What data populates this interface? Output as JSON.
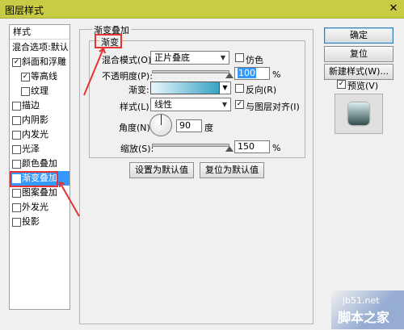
{
  "window": {
    "title": "图层样式",
    "close_glyph": "✕"
  },
  "style_list": {
    "header": "样式",
    "blend_options": "混合选项:默认",
    "items": [
      {
        "label": "斜面和浮雕",
        "checked": true,
        "sub": false
      },
      {
        "label": "等高线",
        "checked": true,
        "sub": true
      },
      {
        "label": "纹理",
        "checked": false,
        "sub": true
      },
      {
        "label": "描边",
        "checked": false,
        "sub": false
      },
      {
        "label": "内阴影",
        "checked": false,
        "sub": false
      },
      {
        "label": "内发光",
        "checked": false,
        "sub": false
      },
      {
        "label": "光泽",
        "checked": false,
        "sub": false
      },
      {
        "label": "颜色叠加",
        "checked": false,
        "sub": false
      },
      {
        "label": "渐变叠加",
        "checked": true,
        "sub": false,
        "selected": true
      },
      {
        "label": "图案叠加",
        "checked": false,
        "sub": false
      },
      {
        "label": "外发光",
        "checked": false,
        "sub": false
      },
      {
        "label": "投影",
        "checked": false,
        "sub": false
      }
    ]
  },
  "panel": {
    "group_title": "渐变叠加",
    "subgroup_title": "渐变",
    "blend_mode_label": "混合模式(O):",
    "blend_mode_value": "正片叠底",
    "dither_label": "仿色",
    "opacity_label": "不透明度(P):",
    "opacity_value": "100",
    "opacity_unit": "%",
    "gradient_label": "渐变:",
    "gradient_colors": [
      "#e9f6fb",
      "#37a3c4"
    ],
    "reverse_label": "反向(R)",
    "style_label": "样式(L):",
    "style_value": "线性",
    "align_label": "与图层对齐(I)",
    "align_checked": true,
    "angle_label": "角度(N):",
    "angle_value": "90",
    "angle_unit": "度",
    "scale_label": "缩放(S):",
    "scale_value": "150",
    "scale_unit": "%",
    "set_default_button": "设置为默认值",
    "reset_default_button": "复位为默认值"
  },
  "right_buttons": {
    "ok": "确定",
    "reset": "复位",
    "new_style": "新建样式(W)...",
    "preview_label": "预览(V)",
    "preview_checked": true
  },
  "watermark": {
    "line1": "jb51.net",
    "line2": "脚本之家"
  },
  "colors": {
    "titlebar": "#c8cc44",
    "selection": "#3399ff",
    "highlight_red": "#e53232"
  }
}
